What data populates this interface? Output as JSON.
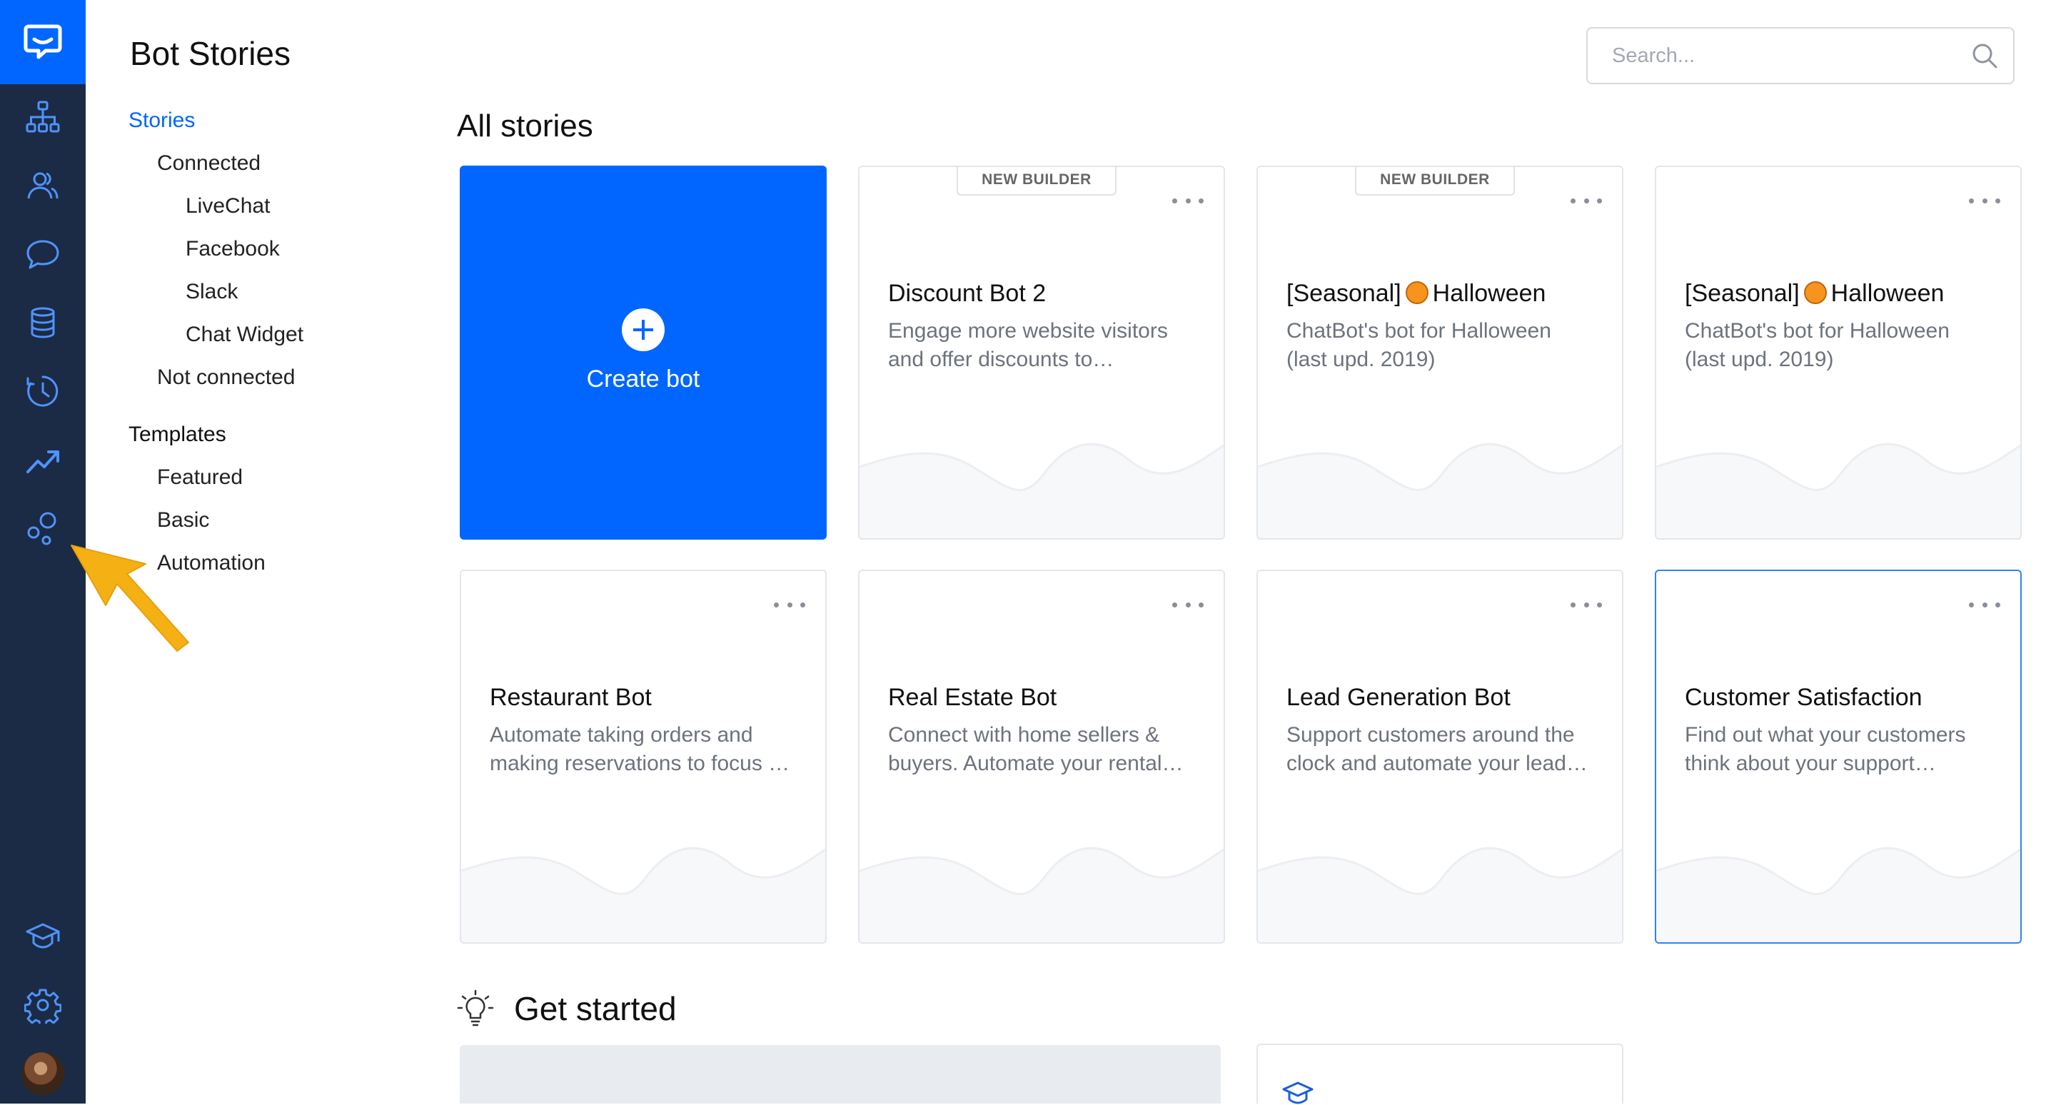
{
  "app": {
    "title": "Bot Stories"
  },
  "colors": {
    "rail": "#1b2b45",
    "brand": "#0066ff",
    "selected_border": "#2f83f0",
    "annotation_arrow": "#f5b014"
  },
  "rail_icons": [
    "chatbot-logo-icon",
    "stories-tree-icon",
    "users-icon",
    "chat-bubble-icon",
    "database-icon",
    "history-clock-icon",
    "reports-trend-icon",
    "integrations-icon",
    "academy-cap-icon",
    "settings-gear-icon"
  ],
  "subnav": {
    "stories": "Stories",
    "connected": "Connected",
    "livechat": "LiveChat",
    "facebook": "Facebook",
    "slack": "Slack",
    "chat_widget": "Chat Widget",
    "not_connected": "Not connected",
    "templates": "Templates",
    "featured": "Featured",
    "basic": "Basic",
    "automation": "Automation"
  },
  "search": {
    "placeholder": "Search..."
  },
  "all_stories": {
    "title": "All stories",
    "create_label": "Create bot",
    "cards": [
      {
        "badge": "NEW BUILDER",
        "title": "Discount Bot 2",
        "desc": "Engage more website visitors and offer discounts to…"
      },
      {
        "badge": "NEW BUILDER",
        "title_pre": "[Seasonal]",
        "title_post": "Halloween",
        "desc": "ChatBot's bot for Halloween (last upd. 2019)"
      },
      {
        "title_pre": "[Seasonal]",
        "title_post": "Halloween",
        "desc": "ChatBot's bot for Halloween (last upd. 2019)"
      },
      {
        "title": "Restaurant Bot",
        "desc": "Automate taking orders and making reservations to focus …"
      },
      {
        "title": "Real Estate Bot",
        "desc": "Connect with home sellers & buyers. Automate your rental…"
      },
      {
        "title": "Lead Generation Bot",
        "desc": "Support customers around the clock and automate your lead…"
      },
      {
        "title": "Customer Satisfaction",
        "desc": "Find out what your customers think about your support…"
      }
    ]
  },
  "get_started": {
    "title": "Get started"
  }
}
